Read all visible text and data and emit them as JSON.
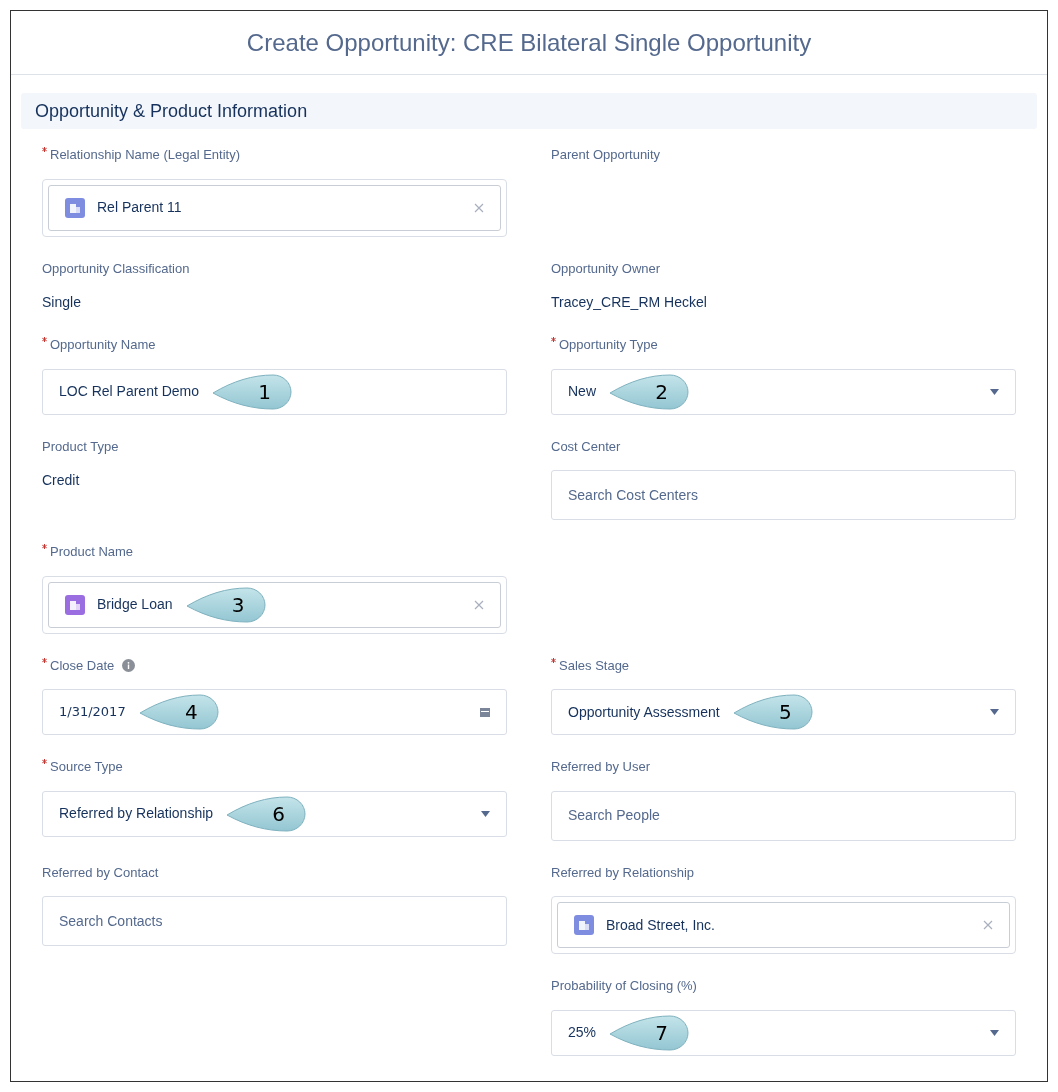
{
  "window": {
    "title": "Create Opportunity: CRE Bilateral Single Opportunity"
  },
  "section": {
    "title": "Opportunity & Product Information"
  },
  "rows": [
    {
      "left": [
        {
          "kind": "lookup",
          "label": "Relationship Name (Legal Entity)",
          "required": true,
          "value": "Rel Parent 11",
          "color": "#7f8de1"
        }
      ],
      "right": [
        {
          "kind": "readonly",
          "label": "Parent Opportunity",
          "required": false
        }
      ]
    },
    {
      "left": [
        {
          "kind": "readonly",
          "label": "Opportunity Classification",
          "required": false,
          "value": "Single"
        }
      ],
      "right": [
        {
          "kind": "readonly",
          "label": "Opportunity Owner",
          "required": false,
          "value": "Tracey_CRE_RM Heckel"
        }
      ]
    },
    {
      "left": [
        {
          "kind": "text",
          "label": "Opportunity Name",
          "required": true,
          "value": "LOC Rel Parent Demo",
          "callout": "1"
        }
      ],
      "right": [
        {
          "kind": "picklist",
          "label": "Opportunity Type",
          "required": true,
          "value": "New",
          "callout": "2"
        }
      ]
    },
    {
      "left": [
        {
          "kind": "readonly",
          "label": "Product Type",
          "required": false,
          "value": "Credit"
        }
      ],
      "right": [
        {
          "kind": "search",
          "label": "Cost Center",
          "required": false,
          "placeholder": "Search Cost Centers"
        }
      ]
    },
    {
      "left": [
        {
          "kind": "lookup",
          "label": "Product Name",
          "required": true,
          "value": "Bridge Loan",
          "color": "#9a6ee0",
          "callout": "3"
        }
      ],
      "right": []
    },
    {
      "left": [
        {
          "kind": "date",
          "label": "Close Date",
          "required": true,
          "info": true,
          "value": "1/31/2017",
          "callout": "4"
        }
      ],
      "right": [
        {
          "kind": "picklist",
          "label": "Sales Stage",
          "required": true,
          "value": "Opportunity Assessment",
          "callout": "5"
        }
      ]
    },
    {
      "left": [
        {
          "kind": "picklist",
          "label": "Source Type",
          "required": true,
          "value": "Referred by Relationship",
          "callout": "6"
        }
      ],
      "right": [
        {
          "kind": "search",
          "label": "Referred by User",
          "required": false,
          "placeholder": "Search People"
        }
      ]
    },
    {
      "left": [
        {
          "kind": "search",
          "label": "Referred by Contact",
          "required": false,
          "placeholder": "Search Contacts"
        }
      ],
      "right": [
        {
          "kind": "lookup",
          "label": "Referred by Relationship",
          "required": false,
          "value": "Broad Street, Inc.",
          "color": "#7f8de1"
        },
        {
          "kind": "picklist",
          "label": "Probability of Closing (%)",
          "required": false,
          "value": "25%",
          "callout": "7"
        }
      ]
    }
  ]
}
